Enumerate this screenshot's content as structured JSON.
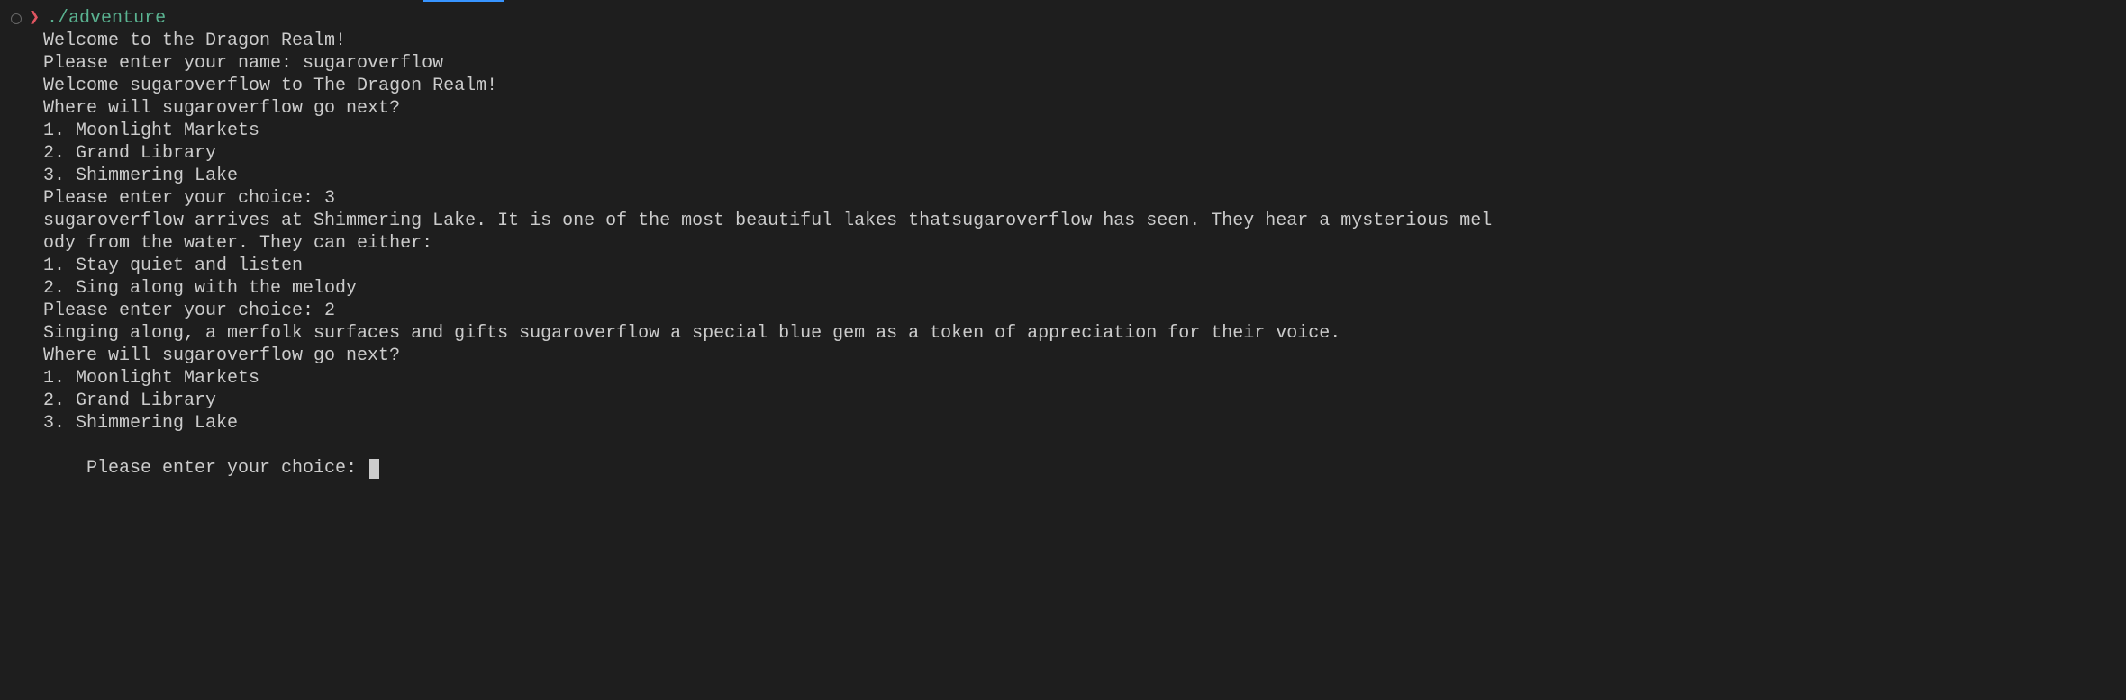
{
  "tab_indicator": true,
  "prompt": {
    "arrow": "❯",
    "command": "./adventure"
  },
  "lines": [
    "Welcome to the Dragon Realm!",
    "Please enter your name: sugaroverflow",
    "Welcome sugaroverflow to The Dragon Realm!",
    "Where will sugaroverflow go next?",
    "1. Moonlight Markets",
    "2. Grand Library",
    "3. Shimmering Lake",
    "Please enter your choice: 3",
    "sugaroverflow arrives at Shimmering Lake. It is one of the most beautiful lakes thatsugaroverflow has seen. They hear a mysterious mel",
    "ody from the water. They can either:",
    "1. Stay quiet and listen",
    "2. Sing along with the melody",
    "Please enter your choice: 2",
    "Singing along, a merfolk surfaces and gifts sugaroverflow a special blue gem as a token of appreciation for their voice.",
    "Where will sugaroverflow go next?",
    "1. Moonlight Markets",
    "2. Grand Library",
    "3. Shimmering Lake"
  ],
  "final_prompt": "Please enter your choice: "
}
